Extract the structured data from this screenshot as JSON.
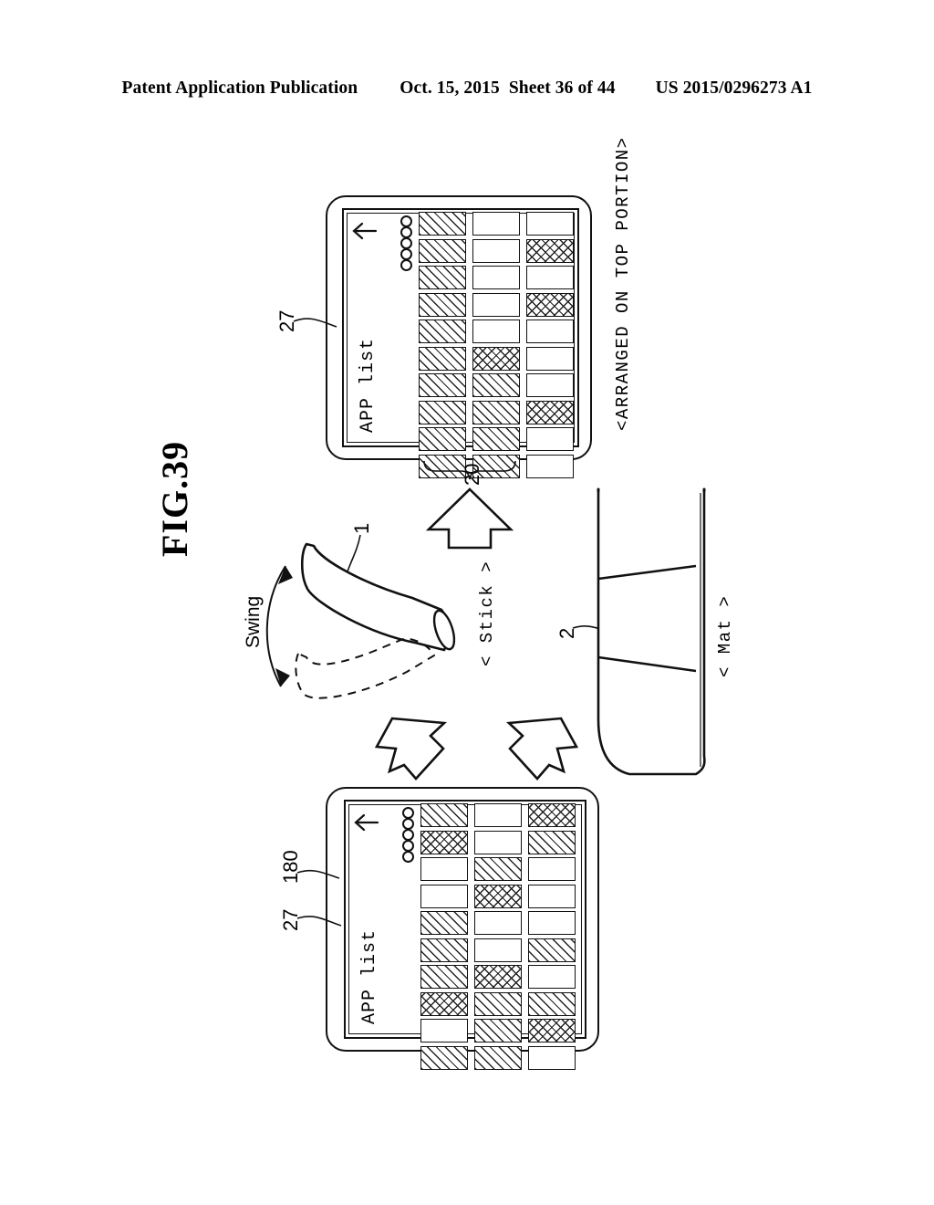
{
  "header": {
    "publication": "Patent Application Publication",
    "date": "Oct. 15, 2015",
    "sheet": "Sheet 36 of 44",
    "number": "US 2015/0296273 A1"
  },
  "figure": {
    "title": "FIG.39"
  },
  "labels": {
    "swing": "Swing",
    "stick": "< Stick >",
    "mat": "< Mat >",
    "arranged_on_top": "<ARRANGED ON TOP PORTION>",
    "ref_stick": "1",
    "ref_mat": "2",
    "ref_20": "20",
    "ref_27_top": "27",
    "ref_27_bottom": "27",
    "ref_180": "180"
  },
  "devices": {
    "top": {
      "screen_title": "APP list",
      "arrow_icon": "down-arrow-icon",
      "indicator_dots": 5,
      "grid": {
        "columns": 3,
        "rows": 10,
        "cells": [
          [
            "diag",
            "diag",
            "diag",
            "diag",
            "diag",
            "diag",
            "diag",
            "diag",
            "diag",
            "diag"
          ],
          [
            "empty",
            "empty",
            "empty",
            "empty",
            "empty",
            "cross",
            "diag",
            "diag",
            "diag",
            "diag"
          ],
          [
            "empty",
            "cross",
            "empty",
            "cross",
            "empty",
            "empty",
            "empty",
            "cross",
            "empty",
            "empty"
          ]
        ]
      }
    },
    "bottom": {
      "screen_title": "APP list",
      "arrow_icon": "down-arrow-icon",
      "indicator_dots": 5,
      "grid": {
        "columns": 3,
        "rows": 10,
        "cells": [
          [
            "diag",
            "cross",
            "empty",
            "empty",
            "diag",
            "diag",
            "diag",
            "cross",
            "empty",
            "diag"
          ],
          [
            "empty",
            "empty",
            "diag",
            "cross",
            "empty",
            "empty",
            "cross",
            "diag",
            "diag",
            "diag"
          ],
          [
            "cross",
            "diag",
            "empty",
            "empty",
            "empty",
            "diag",
            "empty",
            "diag",
            "cross",
            "empty"
          ]
        ]
      }
    }
  }
}
